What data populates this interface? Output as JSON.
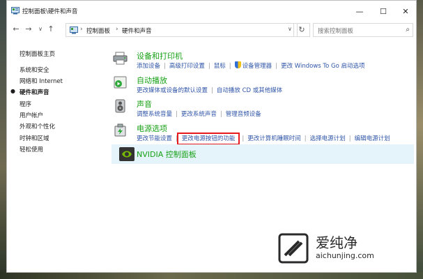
{
  "window": {
    "title": "控制面板\\硬件和声音",
    "minimize": "—",
    "maximize": "☐",
    "close": "✕"
  },
  "nav": {
    "back": "←",
    "forward": "→",
    "history": "∨",
    "up": "↑",
    "breadcrumb": [
      "控制面板",
      "硬件和声音"
    ],
    "separator": "›",
    "dropdown": "∨",
    "refresh": "↻",
    "search_placeholder": "搜索控制面板",
    "search_icon": "⌕"
  },
  "sidebar": {
    "items": [
      {
        "label": "控制面板主页",
        "active": false
      },
      {
        "label": "系统和安全",
        "active": false
      },
      {
        "label": "网络和 Internet",
        "active": false
      },
      {
        "label": "硬件和声音",
        "active": true
      },
      {
        "label": "程序",
        "active": false
      },
      {
        "label": "用户帐户",
        "active": false
      },
      {
        "label": "外观和个性化",
        "active": false
      },
      {
        "label": "时钟和区域",
        "active": false
      },
      {
        "label": "轻松使用",
        "active": false
      }
    ]
  },
  "categories": [
    {
      "title": "设备和打印机",
      "icon": "printer-icon",
      "links": [
        "添加设备",
        "高级打印设置",
        "鼠标",
        "设备管理器",
        "更改 Windows To Go 启动选项"
      ]
    },
    {
      "title": "自动播放",
      "icon": "autoplay-icon",
      "links": [
        "更改媒体或设备的默认设置",
        "自动播放 CD 或其他媒体"
      ]
    },
    {
      "title": "声音",
      "icon": "speaker-icon",
      "links": [
        "调整系统音量",
        "更改系统声音",
        "管理音频设备"
      ]
    },
    {
      "title": "电源选项",
      "icon": "power-icon",
      "links": [
        "更改节能设置",
        "更改电源按钮的功能",
        "更改计算机睡眠时间",
        "选择电源计划",
        "编辑电源计划"
      ]
    }
  ],
  "nvidia": {
    "title": "NVIDIA 控制面板",
    "icon": "nvidia-icon"
  },
  "watermark": {
    "brand": "爱纯净",
    "url": "aichunjing.com"
  }
}
